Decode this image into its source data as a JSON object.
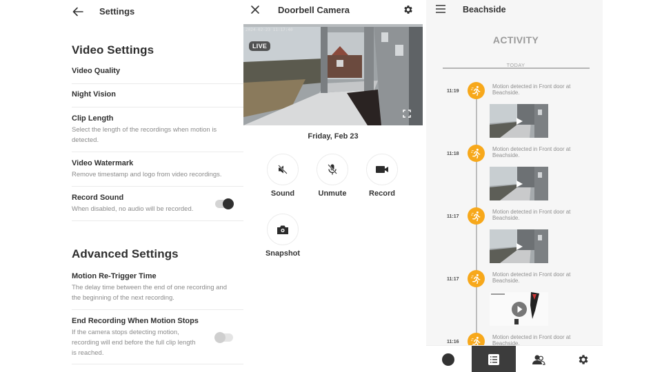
{
  "settings": {
    "title": "Settings",
    "video_section": "Video Settings",
    "video_rows": [
      {
        "title": "Video Quality",
        "desc": ""
      },
      {
        "title": "Night Vision",
        "desc": ""
      },
      {
        "title": "Clip Length",
        "desc": "Select the length of the recordings when motion is detected."
      },
      {
        "title": "Video Watermark",
        "desc": "Remove timestamp and logo from video recordings."
      },
      {
        "title": "Record Sound",
        "desc": "When disabled, no audio will be recorded.",
        "toggle": true
      }
    ],
    "advanced_section": "Advanced Settings",
    "advanced_rows": [
      {
        "title": "Motion Re-Trigger Time",
        "desc": "The delay time between the end of one recording and the beginning of the next recording."
      },
      {
        "title": "End Recording When Motion Stops",
        "desc": "If the camera stops detecting motion, recording will end before the full clip length is reached.",
        "toggle": false
      }
    ]
  },
  "camera": {
    "title": "Doorbell Camera",
    "timestamp": "2024-02-23 11:17:40",
    "live_label": "LIVE",
    "date": "Friday, Feb 23",
    "controls": [
      {
        "label": "Sound",
        "icon": "speaker-muted-icon"
      },
      {
        "label": "Unmute",
        "icon": "mic-muted-icon"
      },
      {
        "label": "Record",
        "icon": "video-camera-icon"
      },
      {
        "label": "Snapshot",
        "icon": "camera-icon"
      }
    ]
  },
  "activity": {
    "location": "Beachside",
    "heading": "ACTIVITY",
    "day_label": "TODAY",
    "accent_color": "#f7a81b",
    "events": [
      {
        "time": "11:19",
        "text": "Motion detected in Front door at Beachside."
      },
      {
        "time": "11:18",
        "text": "Motion detected in Front door at Beachside."
      },
      {
        "time": "11:17",
        "text": "Motion detected in Front door at Beachside."
      },
      {
        "time": "11:17",
        "text": "Motion detected in Front door at Beachside."
      },
      {
        "time": "11:16",
        "text": "Motion detected in Front door at Beachside."
      }
    ],
    "nav": [
      {
        "name": "live-view",
        "icon": "circle-icon",
        "active": false
      },
      {
        "name": "activity",
        "icon": "list-icon",
        "active": true
      },
      {
        "name": "users",
        "icon": "users-icon",
        "active": false
      },
      {
        "name": "settings",
        "icon": "gear-icon",
        "active": false
      }
    ]
  }
}
